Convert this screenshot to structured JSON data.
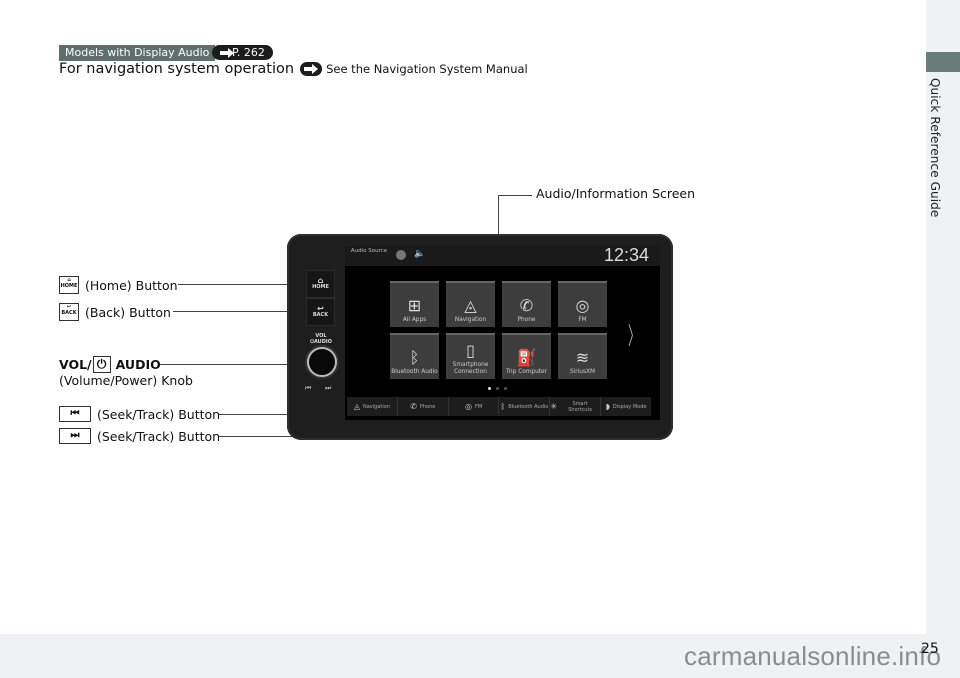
{
  "header": {
    "models_badge": "Models with Display Audio",
    "page_ref": "P. 262",
    "nav_text": "For navigation system operation",
    "nav_see": "See the Navigation System Manual"
  },
  "sidebar": {
    "section_title": "Quick Reference Guide",
    "tab_color": "#6b7d7b"
  },
  "footer": {
    "page_number": "25",
    "watermark": "carmanualsonline.info"
  },
  "callouts": {
    "screen": "Audio/Information Screen",
    "home": "(Home) Button",
    "home_key": "HOME",
    "back": "(Back) Button",
    "back_key": "BACK",
    "vol_title_a": "VOL/",
    "vol_title_b": "AUDIO",
    "vol_sub": "(Volume/Power) Knob",
    "seek_prev": "(Seek/Track) Button",
    "seek_next": "(Seek/Track) Button"
  },
  "unit": {
    "home_label": "HOME",
    "back_label": "BACK",
    "vol_label_1": "VOL",
    "vol_label_2": "AUDIO",
    "screen": {
      "audio_source": "Audio Source",
      "clock": "12:34",
      "tiles": [
        {
          "label": "All Apps",
          "icon": "grid-icon"
        },
        {
          "label": "Navigation",
          "icon": "compass-icon"
        },
        {
          "label": "Phone",
          "icon": "phone-icon"
        },
        {
          "label": "FM",
          "icon": "radio-icon"
        },
        {
          "label": "Bluetooth Audio",
          "icon": "bluetooth-icon"
        },
        {
          "label": "Smartphone Connection",
          "icon": "smartphone-icon"
        },
        {
          "label": "Trip Computer",
          "icon": "fuel-pump-icon"
        },
        {
          "label": "SiriusXM",
          "icon": "siriusxm-icon"
        }
      ],
      "bottom_bar": [
        {
          "label": "Navigation",
          "icon": "compass-icon"
        },
        {
          "label": "Phone",
          "icon": "phone-icon"
        },
        {
          "label": "FM",
          "icon": "radio-icon"
        },
        {
          "label": "Bluetooth Audio",
          "icon": "bluetooth-icon"
        },
        {
          "label": "Smart Shortcuts",
          "icon": "sparkle-icon"
        },
        {
          "label": "Display Mode",
          "icon": "display-mode-icon"
        }
      ],
      "page_indicator": {
        "current": 1,
        "total": 3
      }
    }
  }
}
